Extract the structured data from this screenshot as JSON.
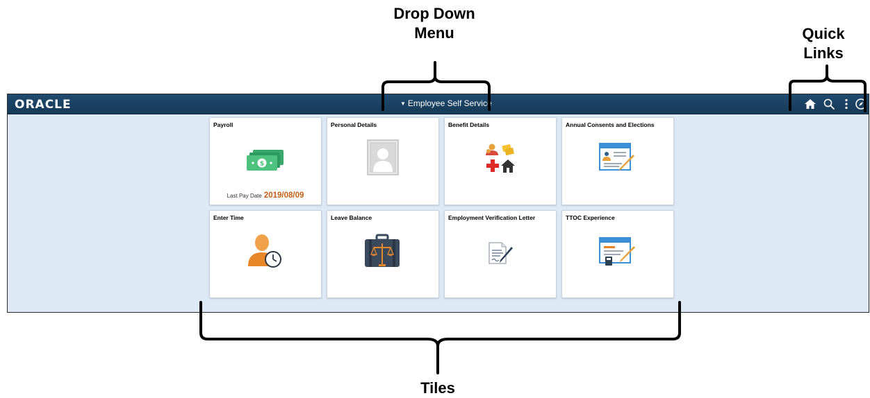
{
  "annotations": {
    "drop_down_menu": "Drop Down Menu",
    "quick_links": "Quick Links",
    "tiles": "Tiles"
  },
  "header": {
    "logo": "ORACLE",
    "menu_label": "Employee Self Service",
    "quick_links": [
      "home-icon",
      "search-icon",
      "actions-menu-icon",
      "navbar-icon"
    ]
  },
  "tiles": [
    {
      "title": "Payroll",
      "icon": "money-icon",
      "footer_label": "Last Pay Date",
      "footer_value": "2019/08/09"
    },
    {
      "title": "Personal Details",
      "icon": "person-placeholder-icon"
    },
    {
      "title": "Benefit Details",
      "icon": "benefits-icon"
    },
    {
      "title": "Annual Consents and Elections",
      "icon": "consent-form-icon"
    },
    {
      "title": "Enter Time",
      "icon": "person-clock-icon"
    },
    {
      "title": "Leave Balance",
      "icon": "briefcase-scales-icon"
    },
    {
      "title": "Employment Verification Letter",
      "icon": "letter-icon"
    },
    {
      "title": "TTOC Experience",
      "icon": "form-calculator-icon"
    }
  ],
  "colors": {
    "header": "#1f4a6e",
    "background": "#dde9f5",
    "pay_date": "#c45f17"
  }
}
